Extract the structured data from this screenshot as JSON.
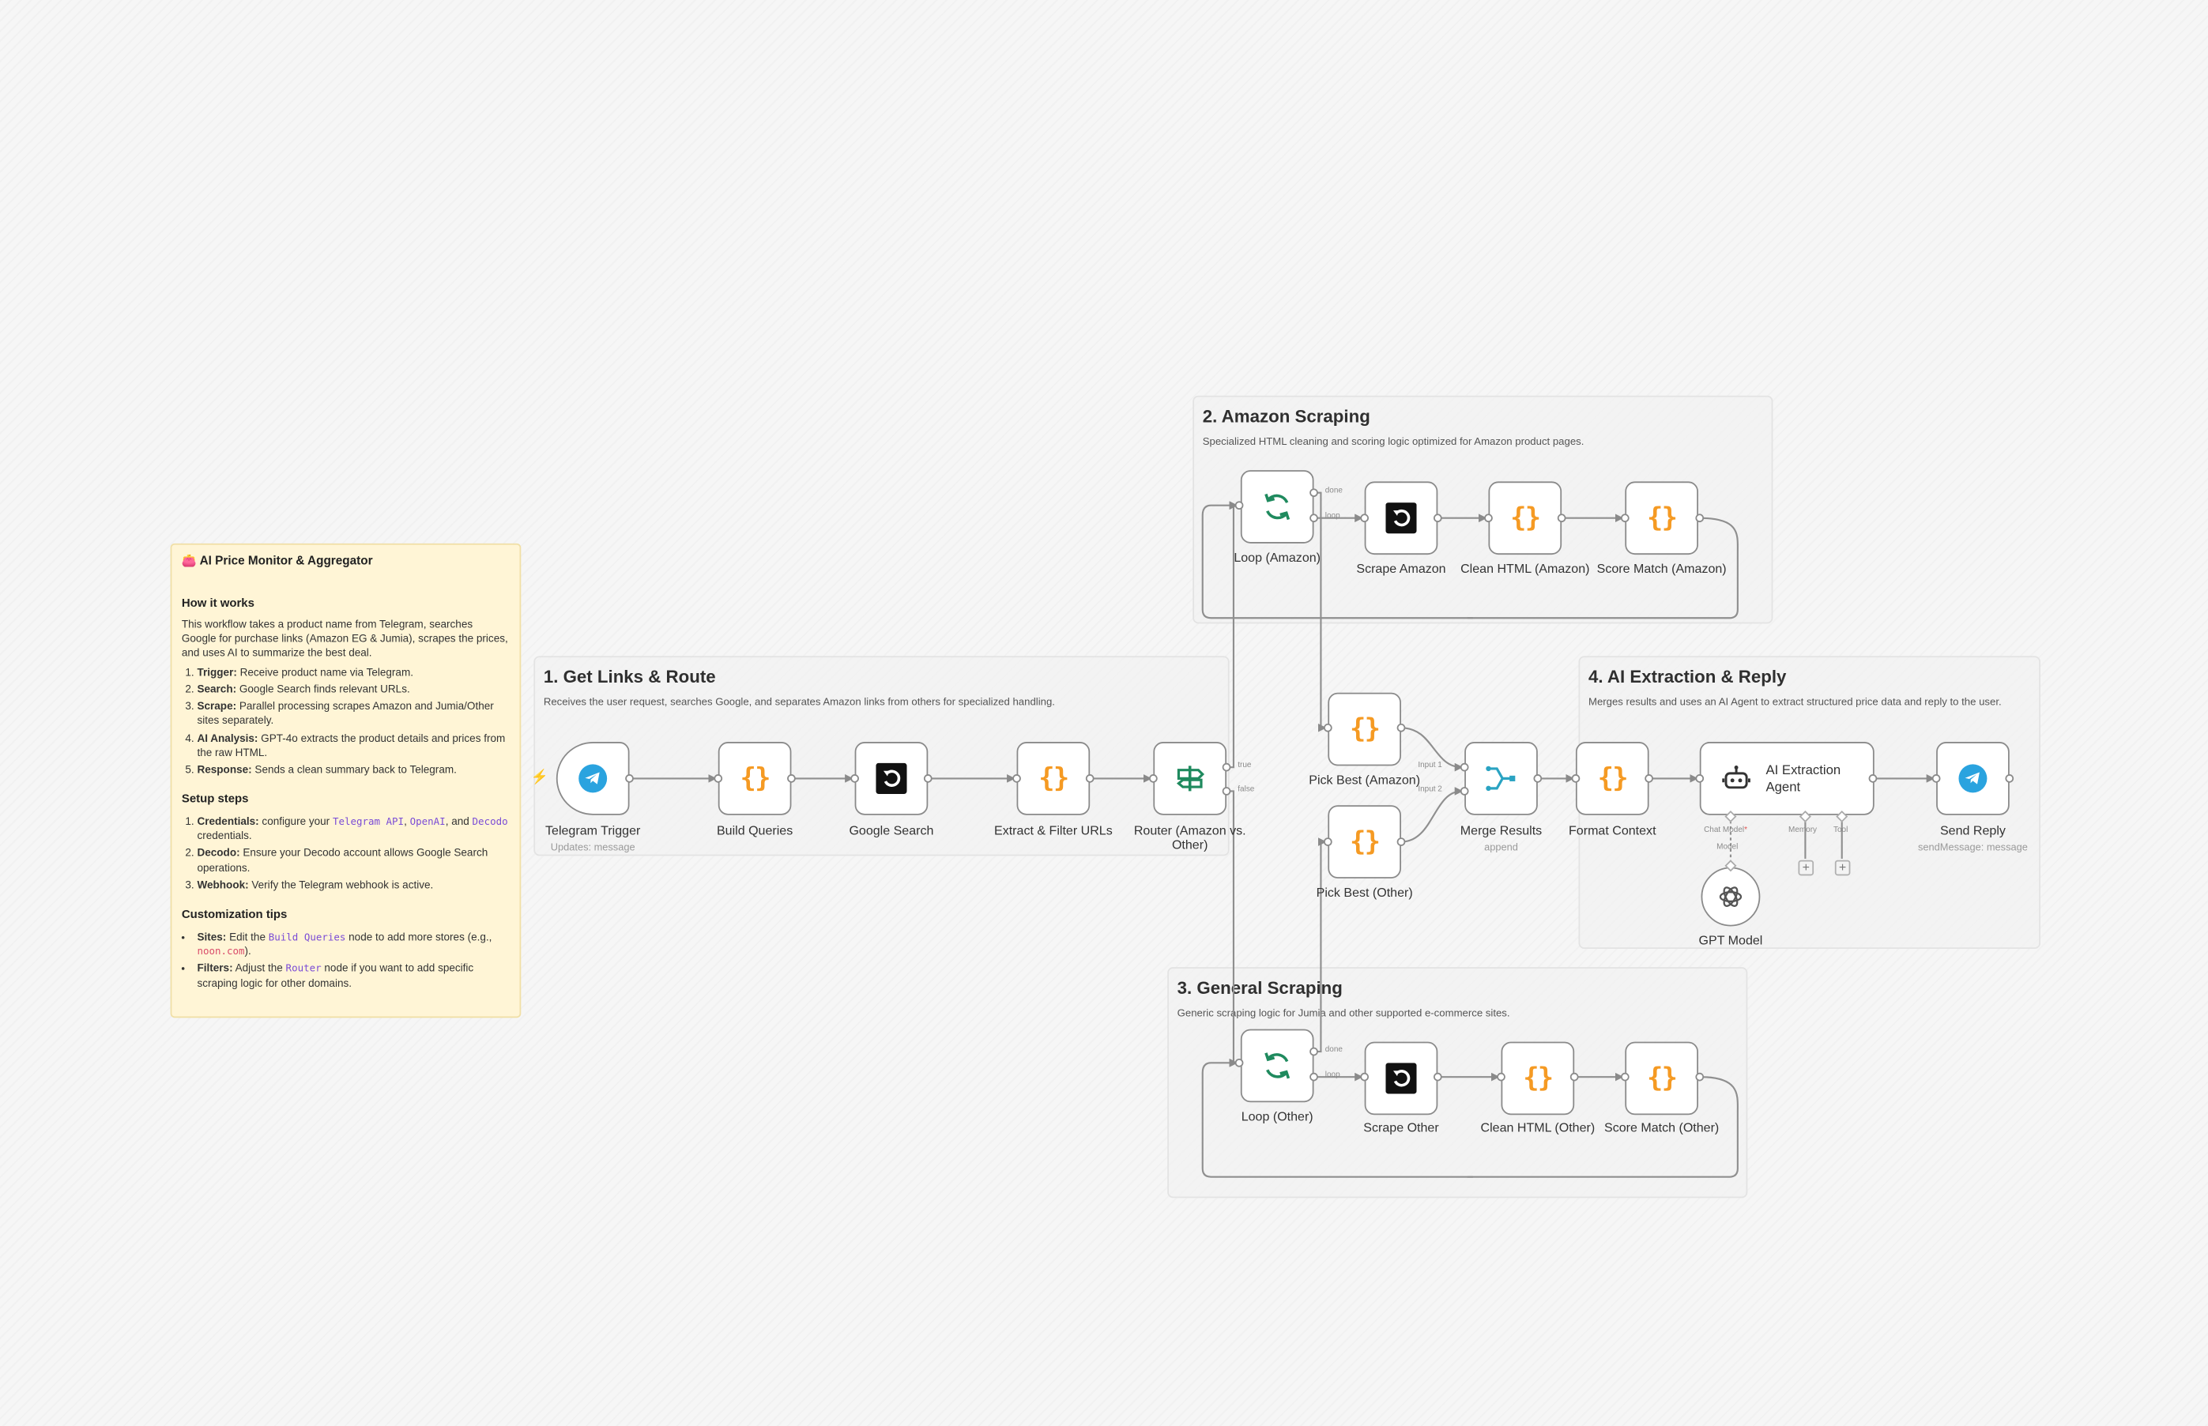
{
  "sticky_note": {
    "title": "👛 AI Price Monitor & Aggregator",
    "how_heading": "How it works",
    "how_intro": "This workflow takes a product name from Telegram, searches Google for purchase links (Amazon EG & Jumia), scrapes the prices, and uses AI to summarize the best deal.",
    "how_steps": [
      {
        "b": "Trigger:",
        "t": " Receive product name via Telegram."
      },
      {
        "b": "Search:",
        "t": " Google Search finds relevant URLs."
      },
      {
        "b": "Scrape:",
        "t": " Parallel processing scrapes Amazon and Jumia/Other sites separately."
      },
      {
        "b": "AI Analysis:",
        "t": " GPT-4o extracts the product details and prices from the raw HTML."
      },
      {
        "b": "Response:",
        "t": " Sends a clean summary back to Telegram."
      }
    ],
    "setup_heading": "Setup steps",
    "setup_1_b": "Credentials:",
    "setup_1_t1": " configure your ",
    "setup_1_c1": "Telegram API",
    "setup_1_t2": ", ",
    "setup_1_c2": "OpenAI",
    "setup_1_t3": ", and ",
    "setup_1_c3": "Decodo",
    "setup_1_t4": " credentials.",
    "setup_2_b": "Decodo:",
    "setup_2_t": " Ensure your Decodo account allows Google Search operations.",
    "setup_3_b": "Webhook:",
    "setup_3_t": " Verify the Telegram webhook is active.",
    "custom_heading": "Customization tips",
    "tip_1_b": "Sites:",
    "tip_1_t1": " Edit the ",
    "tip_1_c1": "Build Queries",
    "tip_1_t2": " node to add more stores (e.g., ",
    "tip_1_c2": "noon.com",
    "tip_1_t3": ").",
    "tip_2_b": "Filters:",
    "tip_2_t1": " Adjust the ",
    "tip_2_c1": "Router",
    "tip_2_t2": " node if you want to add specific scraping logic for other domains."
  },
  "sections": {
    "s1": {
      "title": "1. Get Links & Route",
      "desc": "Receives the user request, searches Google, and separates Amazon links from others for specialized handling."
    },
    "s2": {
      "title": "2. Amazon Scraping",
      "desc": "Specialized HTML cleaning and scoring logic optimized for Amazon product pages."
    },
    "s3": {
      "title": "3. General Scraping",
      "desc": "Generic scraping logic for Jumia and other supported e-commerce sites."
    },
    "s4": {
      "title": "4. AI Extraction & Reply",
      "desc": "Merges results and uses an AI Agent to extract structured price data and reply to the user."
    }
  },
  "nodes": {
    "telegram_trigger": {
      "label": "Telegram Trigger",
      "sub": "Updates: message",
      "icon": "telegram-icon"
    },
    "build_queries": {
      "label": "Build Queries",
      "icon": "code-icon"
    },
    "google_search": {
      "label": "Google Search",
      "icon": "decodo-icon"
    },
    "extract_filter": {
      "label": "Extract & Filter URLs",
      "icon": "code-icon"
    },
    "router": {
      "label": "Router (Amazon vs.",
      "label2": "Other)",
      "port_true": "true",
      "port_false": "false",
      "icon": "signpost-icon"
    },
    "loop_amazon": {
      "label": "Loop (Amazon)",
      "port_done": "done",
      "port_loop": "loop",
      "icon": "loop-icon"
    },
    "scrape_amazon": {
      "label": "Scrape Amazon",
      "icon": "decodo-icon"
    },
    "clean_amazon": {
      "label": "Clean HTML (Amazon)",
      "icon": "code-icon"
    },
    "score_amazon": {
      "label": "Score Match (Amazon)",
      "icon": "code-icon"
    },
    "pick_amazon": {
      "label": "Pick Best (Amazon)",
      "icon": "code-icon"
    },
    "pick_other": {
      "label": "Pick Best (Other)",
      "icon": "code-icon"
    },
    "merge": {
      "label": "Merge Results",
      "sub": "append",
      "port_in1": "Input 1",
      "port_in2": "Input 2",
      "icon": "merge-icon"
    },
    "format_context": {
      "label": "Format Context",
      "icon": "code-icon"
    },
    "ai_agent": {
      "label": "AI Extraction Agent",
      "port_chat": "Chat Model",
      "port_chat_req": "*",
      "port_memory": "Memory",
      "port_tool": "Tool",
      "icon": "robot-icon"
    },
    "gpt_model": {
      "label": "GPT Model",
      "port_model": "Model",
      "icon": "openai-icon"
    },
    "send_reply": {
      "label": "Send Reply",
      "sub": "sendMessage: message",
      "icon": "telegram-icon"
    },
    "loop_other": {
      "label": "Loop (Other)",
      "port_done": "done",
      "port_loop": "loop",
      "icon": "loop-icon"
    },
    "scrape_other": {
      "label": "Scrape Other",
      "icon": "decodo-icon"
    },
    "clean_other": {
      "label": "Clean HTML (Other)",
      "icon": "code-icon"
    },
    "score_other": {
      "label": "Score Match (Other)",
      "icon": "code-icon"
    }
  },
  "icons": {
    "code_glyph": "{}",
    "plus_glyph": "+",
    "bolt_glyph": "⚡"
  },
  "colors": {
    "telegram": "#2aa3df",
    "code": "#f59a23",
    "loop": "#1f8a5e",
    "merge": "#2aa3c2",
    "trigger_bolt": "#ff6d5a",
    "sticky_bg": "#fff5d6"
  }
}
